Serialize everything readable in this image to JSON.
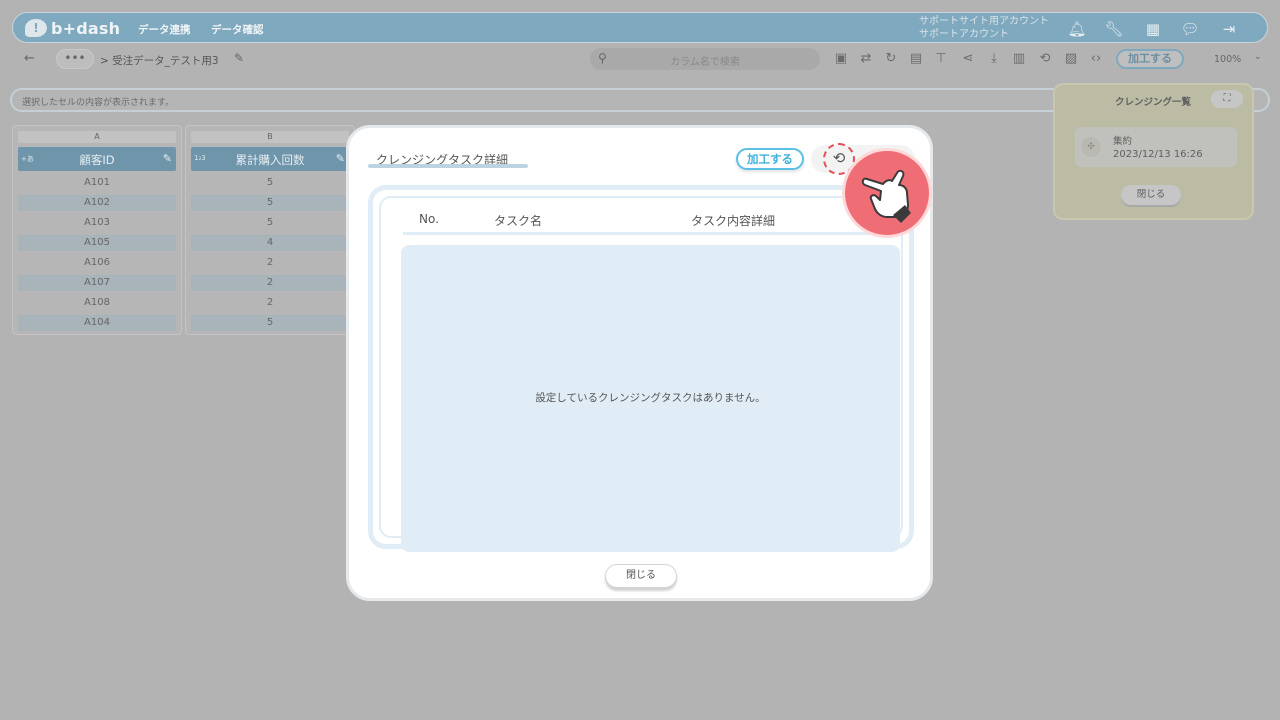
{
  "app": {
    "logo_text": "b+dash"
  },
  "nav": {
    "items": [
      "データ連携",
      "データ確認"
    ]
  },
  "account": {
    "line1": "サポートサイト用アカウント",
    "line2": "サポートアカウント"
  },
  "top_icons": [
    "bell-icon",
    "wrench-icon",
    "apps-grid-icon",
    "chat-icon",
    "logout-icon"
  ],
  "toolbar": {
    "more_label": "•••",
    "breadcrumb": "> 受注データ_テスト用3",
    "search_placeholder": "カラム名で検索",
    "icons": [
      "csv-icon",
      "swap-icon",
      "refresh-icon",
      "clipboard-icon",
      "hierarchy-icon",
      "share-icon",
      "download-icon",
      "trash-icon",
      "history-icon",
      "save-icon",
      "code-icon"
    ],
    "process_label": "加工する",
    "zoom": "100%"
  },
  "preview": {
    "text": "選択したセルの内容が表示されます。"
  },
  "columns": [
    {
      "letter": "A",
      "type": "+あ",
      "name": "顧客ID",
      "cells": [
        "A101",
        "A102",
        "A103",
        "A105",
        "A106",
        "A107",
        "A108",
        "A104"
      ]
    },
    {
      "letter": "B",
      "type": "1₂3",
      "name": "累計購入回数",
      "cells": [
        "5",
        "5",
        "5",
        "4",
        "2",
        "2",
        "2",
        "5"
      ]
    }
  ],
  "cleansing_panel": {
    "title": "クレンジング一覧",
    "item_title": "集約",
    "item_date": "2023/12/13 16:26",
    "close_label": "閉じる"
  },
  "modal": {
    "title": "クレンジングタスク詳細",
    "process_label": "加工する",
    "headers": [
      "No.",
      "タスク名",
      "タスク内容詳細"
    ],
    "empty_message": "設定しているクレンジングタスクはありません。",
    "close_label": "閉じる"
  },
  "colors": {
    "accent": "#3fb1dc",
    "highlight": "#e2515a",
    "pointer": "#ef6e76"
  }
}
